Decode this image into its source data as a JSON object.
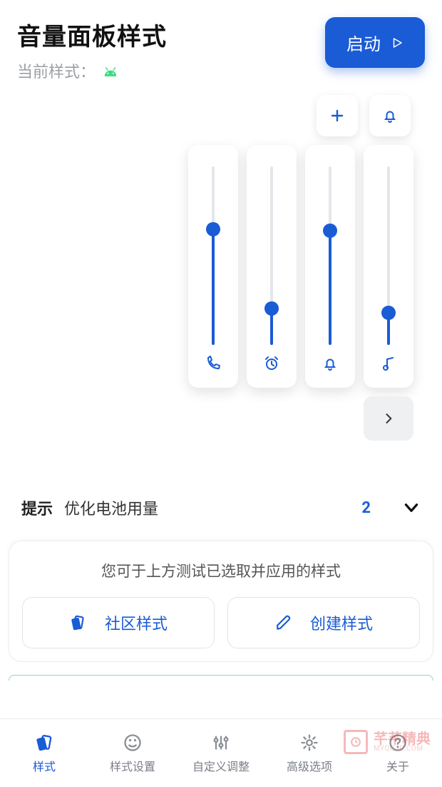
{
  "header": {
    "title": "音量面板样式",
    "subtitle": "当前样式：",
    "current_style_icon": "android-icon",
    "launch_label": "启动"
  },
  "preview": {
    "top_buttons": [
      {
        "name": "add-icon"
      },
      {
        "name": "bell-icon"
      }
    ],
    "sliders": [
      {
        "icon": "phone-icon",
        "value_pct": 64
      },
      {
        "icon": "alarm-icon",
        "value_pct": 22
      },
      {
        "icon": "bell-icon",
        "value_pct": 63
      },
      {
        "icon": "music-icon",
        "value_pct": 20
      }
    ],
    "expand_icon": "chevron-right-icon"
  },
  "tip": {
    "label": "提示",
    "text": "优化电池用量",
    "count": "2"
  },
  "card": {
    "message": "您可于上方测试已选取并应用的样式",
    "community_label": "社区样式",
    "create_label": "创建样式"
  },
  "nav": {
    "items": [
      {
        "label": "样式",
        "icon": "styles-icon",
        "active": true
      },
      {
        "label": "样式设置",
        "icon": "palette-icon",
        "active": false
      },
      {
        "label": "自定义调整",
        "icon": "sliders-icon",
        "active": false
      },
      {
        "label": "高级选项",
        "icon": "gear-icon",
        "active": false
      },
      {
        "label": "关于",
        "icon": "help-icon",
        "active": false
      }
    ]
  },
  "watermark": {
    "cn": "芊芊精典",
    "en": "MYQQJD.COM"
  },
  "colors": {
    "accent": "#1a5bd6"
  }
}
